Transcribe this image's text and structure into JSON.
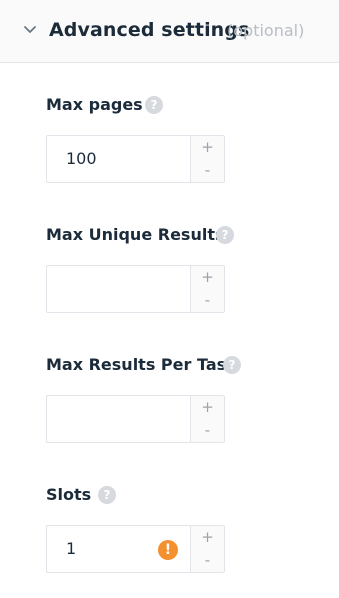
{
  "header": {
    "title": "Advanced settings",
    "optional_label": "(optional)",
    "chevron_icon": "chevron-down-icon"
  },
  "fields": [
    {
      "label": "Max pages",
      "value": "100",
      "placeholder": "",
      "help_icon": "?",
      "plus": "+",
      "minus": "-"
    },
    {
      "label": "Max Unique Results",
      "value": "",
      "placeholder": "",
      "help_icon": "?",
      "plus": "+",
      "minus": "-"
    },
    {
      "label": "Max Results Per Task",
      "value": "",
      "placeholder": "",
      "help_icon": "?",
      "plus": "+",
      "minus": "-"
    },
    {
      "label": "Slots",
      "value": "1",
      "placeholder": "",
      "help_icon": "?",
      "warning_icon": "!",
      "plus": "+",
      "minus": "-"
    }
  ],
  "colors": {
    "text": "#1c2b3a",
    "muted": "#b8bec5",
    "warning": "#f5902f",
    "help": "#d6dadf"
  }
}
